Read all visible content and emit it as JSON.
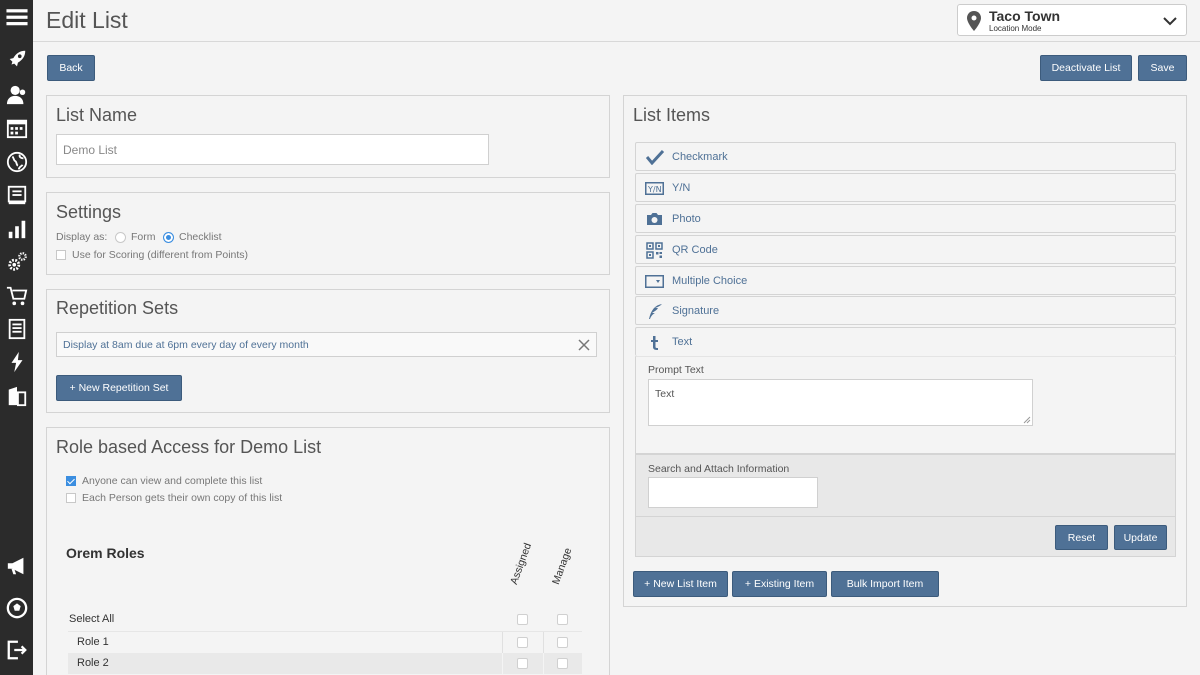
{
  "header": {
    "title": "Edit List",
    "location_name": "Taco Town",
    "location_mode": "Location Mode"
  },
  "toolbar": {
    "back_label": "Back",
    "deactivate_label": "Deactivate List",
    "save_label": "Save"
  },
  "list_name": {
    "title": "List Name",
    "value": "Demo List"
  },
  "settings": {
    "title": "Settings",
    "display_as_label": "Display as:",
    "option_form": "Form",
    "option_checklist": "Checklist",
    "selected": "Checklist",
    "scoring_label": "Use for Scoring (different from Points)"
  },
  "repetition": {
    "title": "Repetition Sets",
    "set_text": "Display at 8am due at 6pm every day of every month",
    "new_button": "+ New Repetition Set"
  },
  "access": {
    "title": "Role based Access for Demo List",
    "anyone_label": "Anyone can view and complete this list",
    "own_copy_label": "Each Person gets their own copy of this list",
    "group_title": "Orem Roles",
    "col_assigned": "Assigned",
    "col_manage": "Manage",
    "select_all": "Select All",
    "roles": [
      "Role 1",
      "Role 2"
    ]
  },
  "list_items": {
    "title": "List Items",
    "items": [
      {
        "label": "Checkmark",
        "icon": "checkmark-icon"
      },
      {
        "label": "Y/N",
        "icon": "yes-no-icon"
      },
      {
        "label": "Photo",
        "icon": "camera-icon"
      },
      {
        "label": "QR Code",
        "icon": "qr-code-icon"
      },
      {
        "label": "Multiple Choice",
        "icon": "dropdown-icon"
      },
      {
        "label": "Signature",
        "icon": "quill-icon"
      },
      {
        "label": "Text",
        "icon": "text-icon"
      }
    ],
    "prompt_label": "Prompt Text",
    "prompt_value": "Text",
    "search_label": "Search and Attach Information",
    "reset_label": "Reset",
    "update_label": "Update",
    "new_item": "+ New List Item",
    "existing_item": "+ Existing Item",
    "bulk_import": "Bulk Import Item"
  },
  "sidebar_icons": [
    "menu-icon",
    "rocket-icon",
    "people-icon",
    "calendar-icon",
    "globe-icon",
    "book-icon",
    "bar-chart-icon",
    "gears-icon",
    "cart-icon",
    "document-icon",
    "lightning-icon",
    "building-icon",
    "megaphone-icon",
    "soccer-ball-icon",
    "logout-icon"
  ]
}
